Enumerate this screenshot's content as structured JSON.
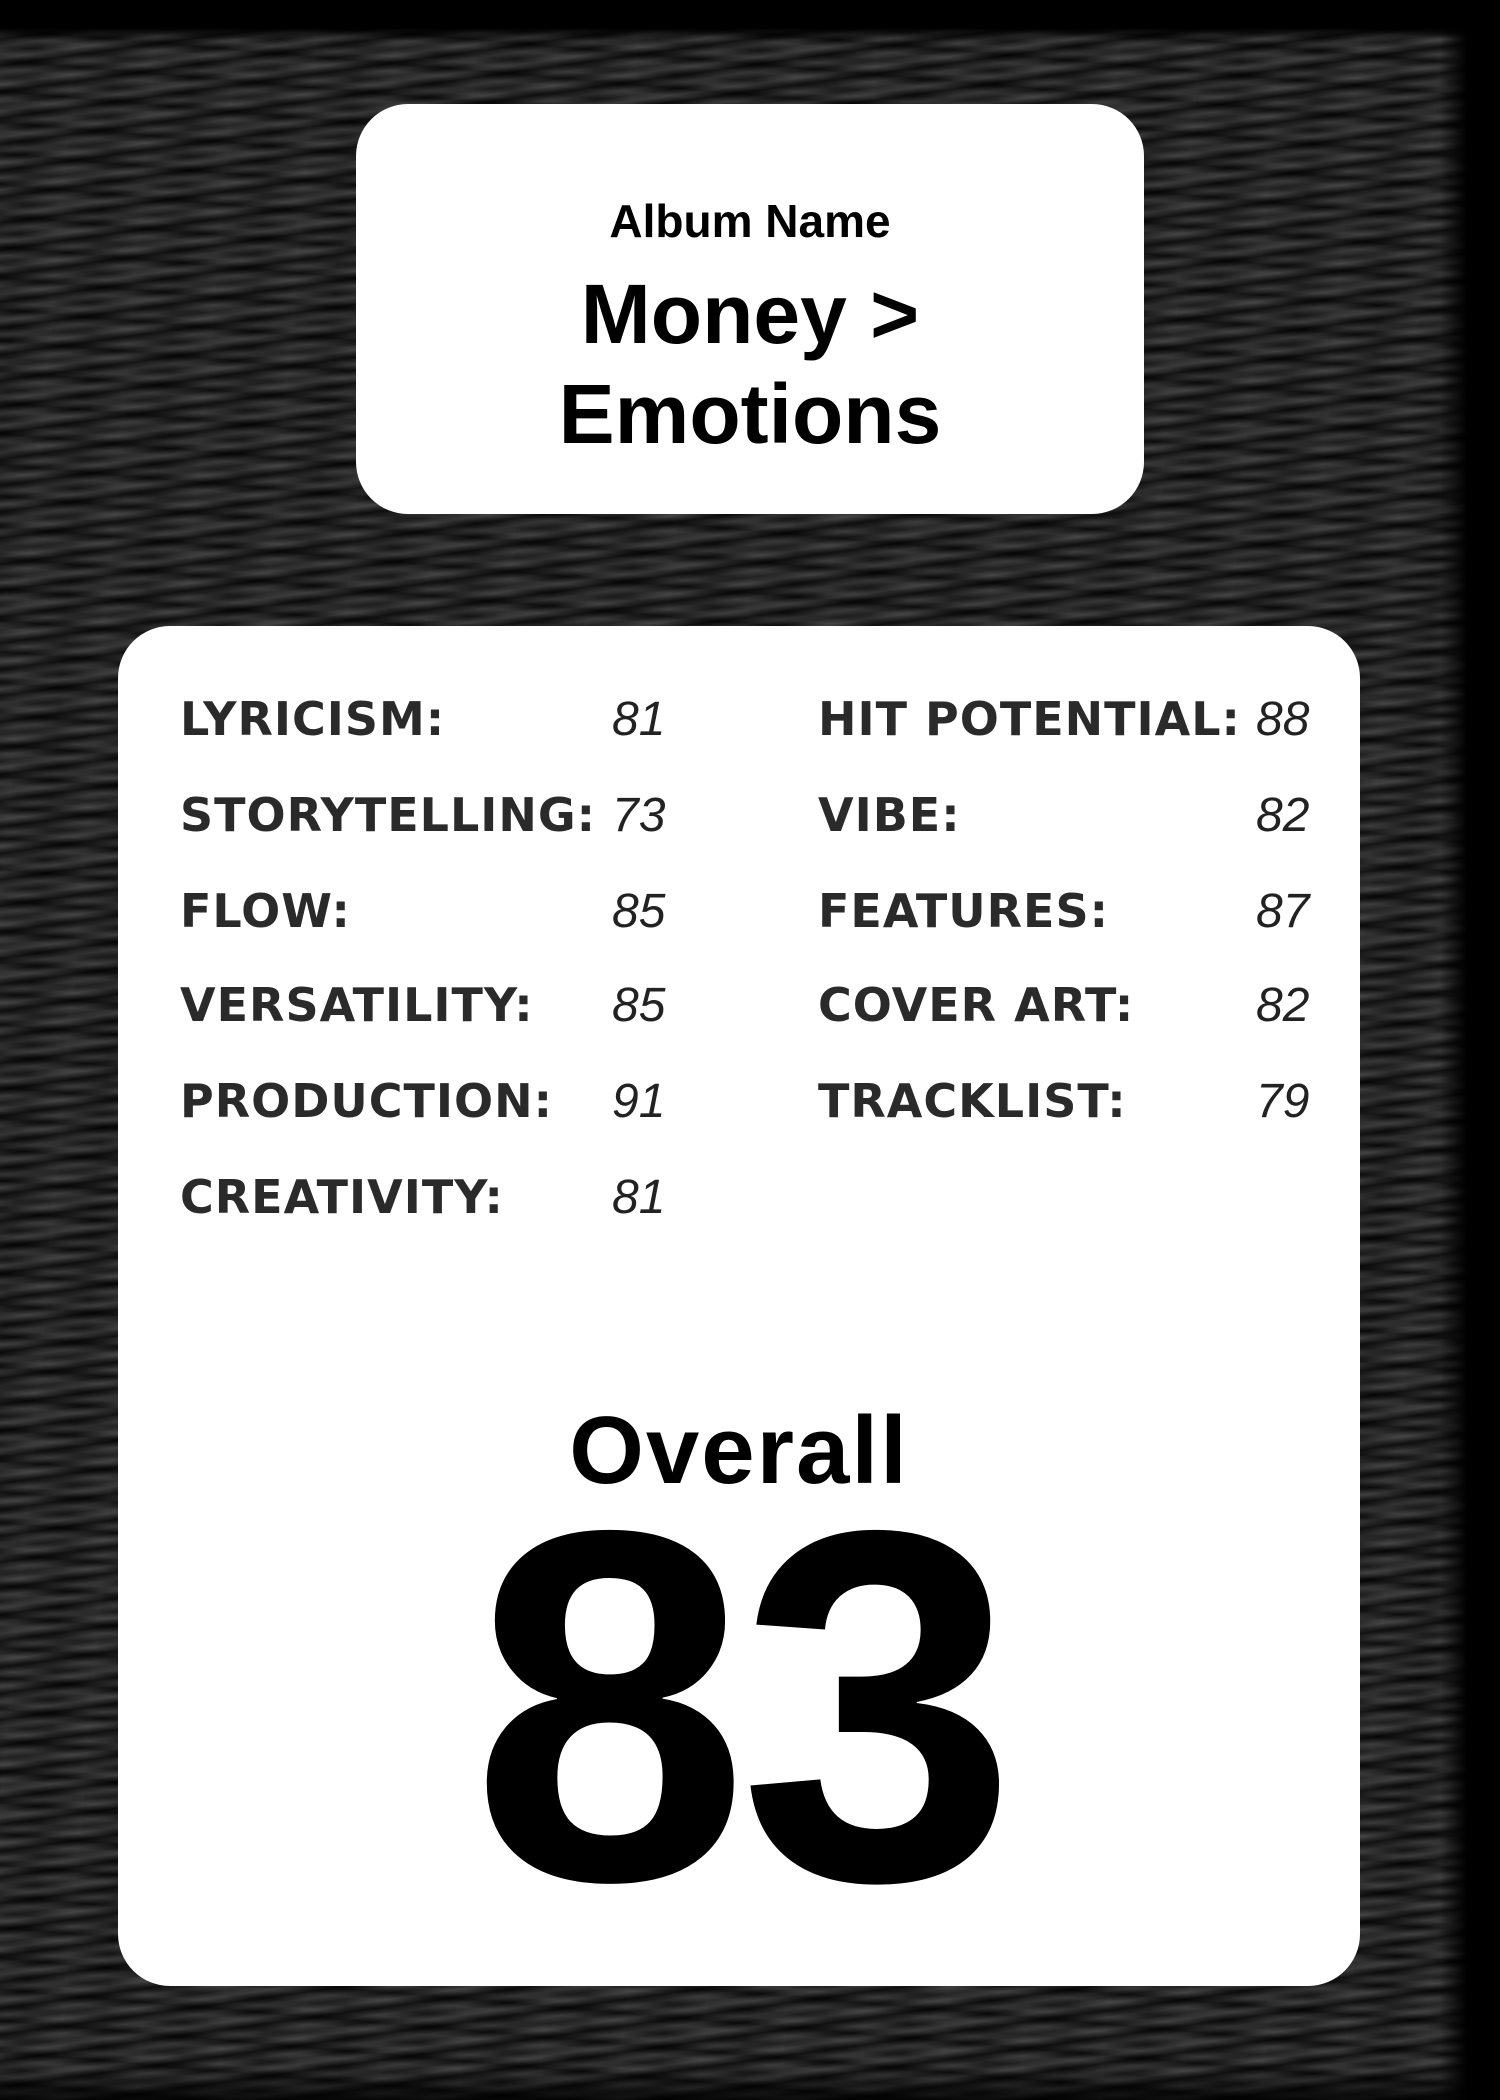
{
  "album": {
    "label": "Album Name",
    "title_line1": "Money >",
    "title_line2": "Emotions"
  },
  "stats_left": [
    {
      "label": "Lyricism:",
      "value": "81"
    },
    {
      "label": "Storytelling:",
      "value": "73"
    },
    {
      "label": "Flow:",
      "value": "85"
    },
    {
      "label": "Versatility:",
      "value": "85"
    },
    {
      "label": "Production:",
      "value": "91"
    },
    {
      "label": "Creativity:",
      "value": "81"
    }
  ],
  "stats_right": [
    {
      "label": "Hit Potential:",
      "value": "88"
    },
    {
      "label": "Vibe:",
      "value": "82"
    },
    {
      "label": "Features:",
      "value": "87"
    },
    {
      "label": "Cover Art:",
      "value": "82"
    },
    {
      "label": "Tracklist:",
      "value": "79"
    }
  ],
  "overall": {
    "label": "Overall",
    "score": "83"
  },
  "colors": {
    "background": "#1a1a1a",
    "card": "#ffffff",
    "text": "#000000"
  }
}
